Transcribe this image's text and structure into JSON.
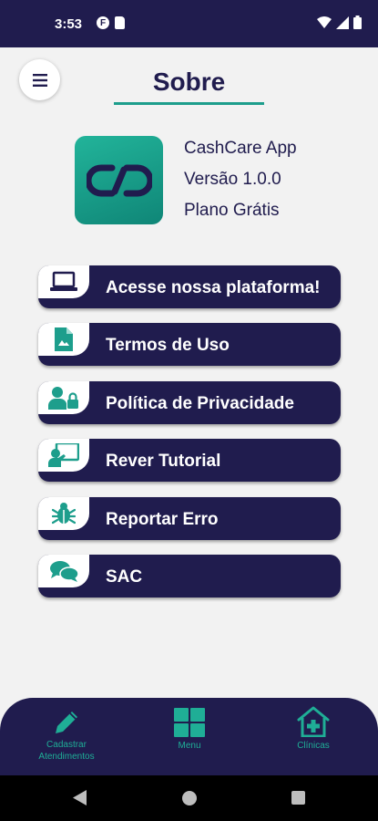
{
  "status_bar": {
    "time": "3:53",
    "badge_letter": "F"
  },
  "header": {
    "title": "Sobre",
    "menu_icon": "hamburger-icon"
  },
  "app_info": {
    "name": "CashCare App",
    "version": "Versão 1.0.0",
    "plan": "Plano Grátis",
    "logo_icon": "link-icon"
  },
  "options": [
    {
      "label": "Acesse nossa plataforma!",
      "icon": "laptop-icon"
    },
    {
      "label": "Termos de Uso",
      "icon": "document-icon"
    },
    {
      "label": "Política de Privacidade",
      "icon": "user-lock-icon"
    },
    {
      "label": "Rever Tutorial",
      "icon": "presentation-icon"
    },
    {
      "label": "Reportar Erro",
      "icon": "bug-icon"
    },
    {
      "label": "SAC",
      "icon": "chat-icon"
    }
  ],
  "bottom_nav": [
    {
      "label_line1": "Cadastrar",
      "label_line2": "Atendimentos",
      "icon": "pencil-icon"
    },
    {
      "label_line1": "Menu",
      "label_line2": "",
      "icon": "grid-icon"
    },
    {
      "label_line1": "Clínicas",
      "label_line2": "",
      "icon": "hospital-icon"
    }
  ],
  "colors": {
    "primary": "#201c4e",
    "accent": "#1d9e8c",
    "background": "#f2f2f2"
  }
}
